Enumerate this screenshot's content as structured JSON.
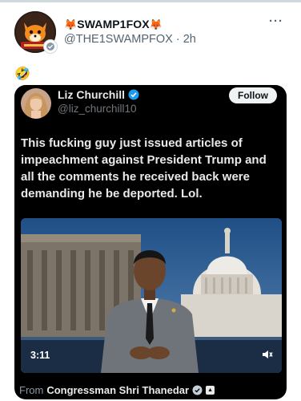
{
  "post": {
    "author": {
      "display_name": "SWAMP1FOX",
      "name_emoji_left": "🦊",
      "name_emoji_right": "🦊",
      "handle": "@THE1SWAMPFOX",
      "separator": " · ",
      "time": "2h",
      "avatar_icon": "fox-avatar",
      "badge_icon": "affiliate-badge-icon"
    },
    "more_icon": "more-options-icon",
    "more_glyph": "···",
    "text": "🤣"
  },
  "quoted": {
    "author": {
      "display_name": "Liz Churchill",
      "handle": "@liz_churchill10",
      "verified_icon": "verified-badge-icon"
    },
    "follow_label": "Follow",
    "text": "This fucking guy just issued articles of impeachment against President Trump and all the comments he received back were demanding he be deported. Lol.",
    "video": {
      "duration": "3:11",
      "mute_icon": "volume-icon"
    },
    "source": {
      "prefix": "From",
      "name": "Congressman Shri Thanedar",
      "verified_icon": "verified-gray-badge-icon",
      "flag_icon": "flag-icon"
    }
  },
  "colors": {
    "text_primary": "#0f1419",
    "text_secondary": "#536471",
    "card_bg": "#000000",
    "card_text": "#e7e9ea",
    "verified_blue": "#1d9bf0"
  }
}
